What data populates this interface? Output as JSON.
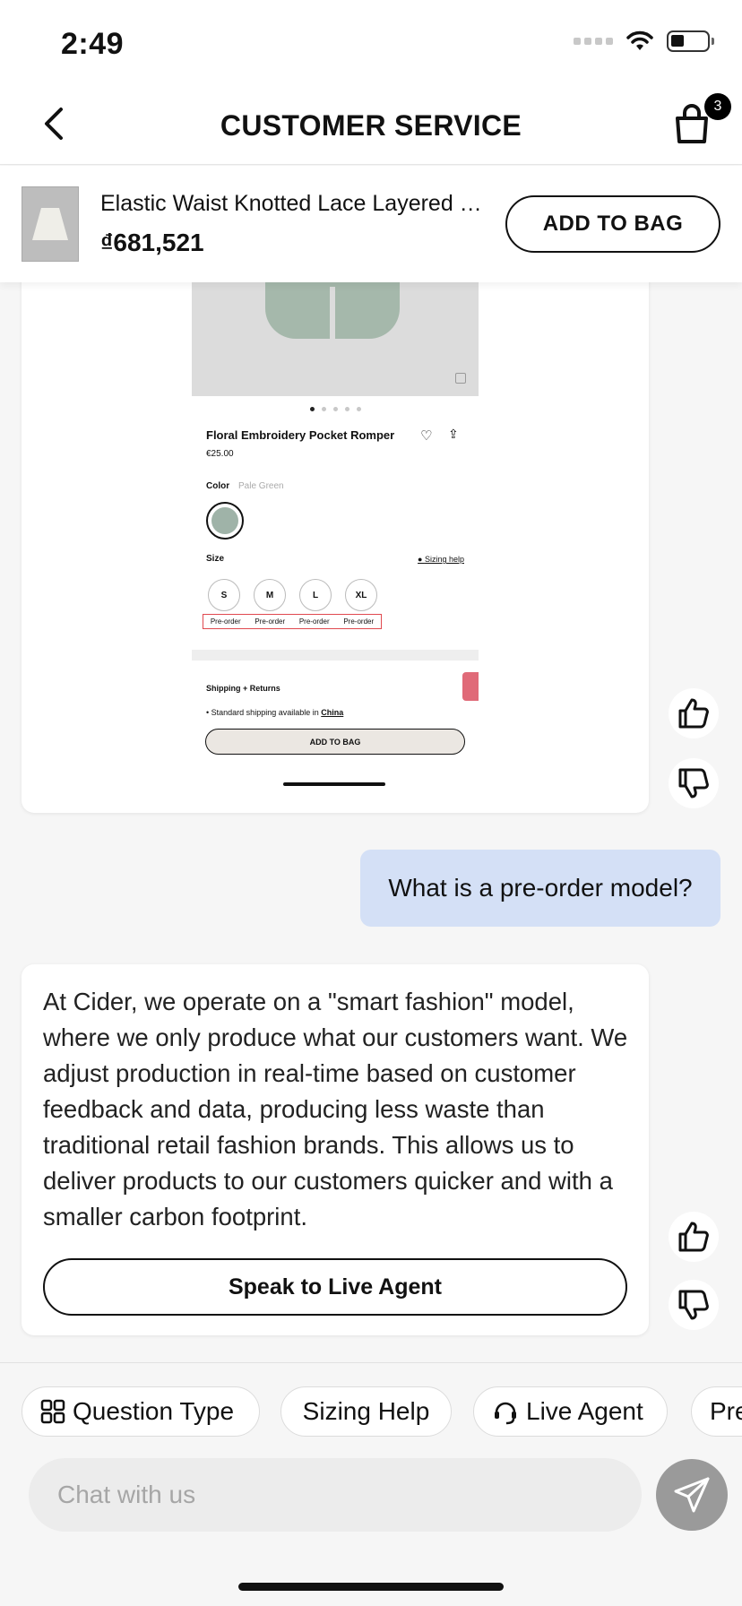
{
  "status_bar": {
    "time": "2:49"
  },
  "header": {
    "title": "CUSTOMER SERVICE",
    "bag_count": "3",
    "icons": {
      "back": "chevron-left-icon",
      "bag": "shopping-bag-icon"
    }
  },
  "product": {
    "name": "Elastic Waist Knotted Lace Layered Skirt",
    "price": "₫681,521",
    "add_to_bag": "ADD TO BAG"
  },
  "shared_screenshot": {
    "title": "Floral Embroidery Pocket Romper",
    "price": "€25.00",
    "color_label": "Color",
    "color_value": "Pale Green",
    "size_label": "Size",
    "sizing_help": "Sizing help",
    "sizes": [
      "S",
      "M",
      "L",
      "XL"
    ],
    "preorder": [
      "Pre-order",
      "Pre-order",
      "Pre-order",
      "Pre-order"
    ],
    "shipping_title": "Shipping + Returns",
    "shipping_text": "Standard shipping available in",
    "shipping_country": "China",
    "add_to_bag": "ADD TO BAG",
    "swatch_color": "#9fb3a8"
  },
  "messages": {
    "user": "What is a pre-order model?",
    "bot": "At Cider, we operate on a \"smart fashion\" model, where we only produce what our customers want. We adjust production in real-time based on customer feedback and data, producing less waste than traditional retail fashion brands. This allows us to deliver products to our customers quicker and with a smaller carbon footprint.",
    "live_agent_button": "Speak to Live Agent"
  },
  "quick_replies": [
    {
      "label": "Question Type",
      "icon": "grid-icon"
    },
    {
      "label": "Sizing Help",
      "icon": ""
    },
    {
      "label": "Live Agent",
      "icon": "headset-icon"
    },
    {
      "label": "Pre",
      "icon": ""
    }
  ],
  "chat": {
    "placeholder": "Chat with us"
  },
  "colors": {
    "user_bubble": "#d4e0f6",
    "send_button": "#9a9a9a",
    "preorder_outline": "#e0494f"
  }
}
